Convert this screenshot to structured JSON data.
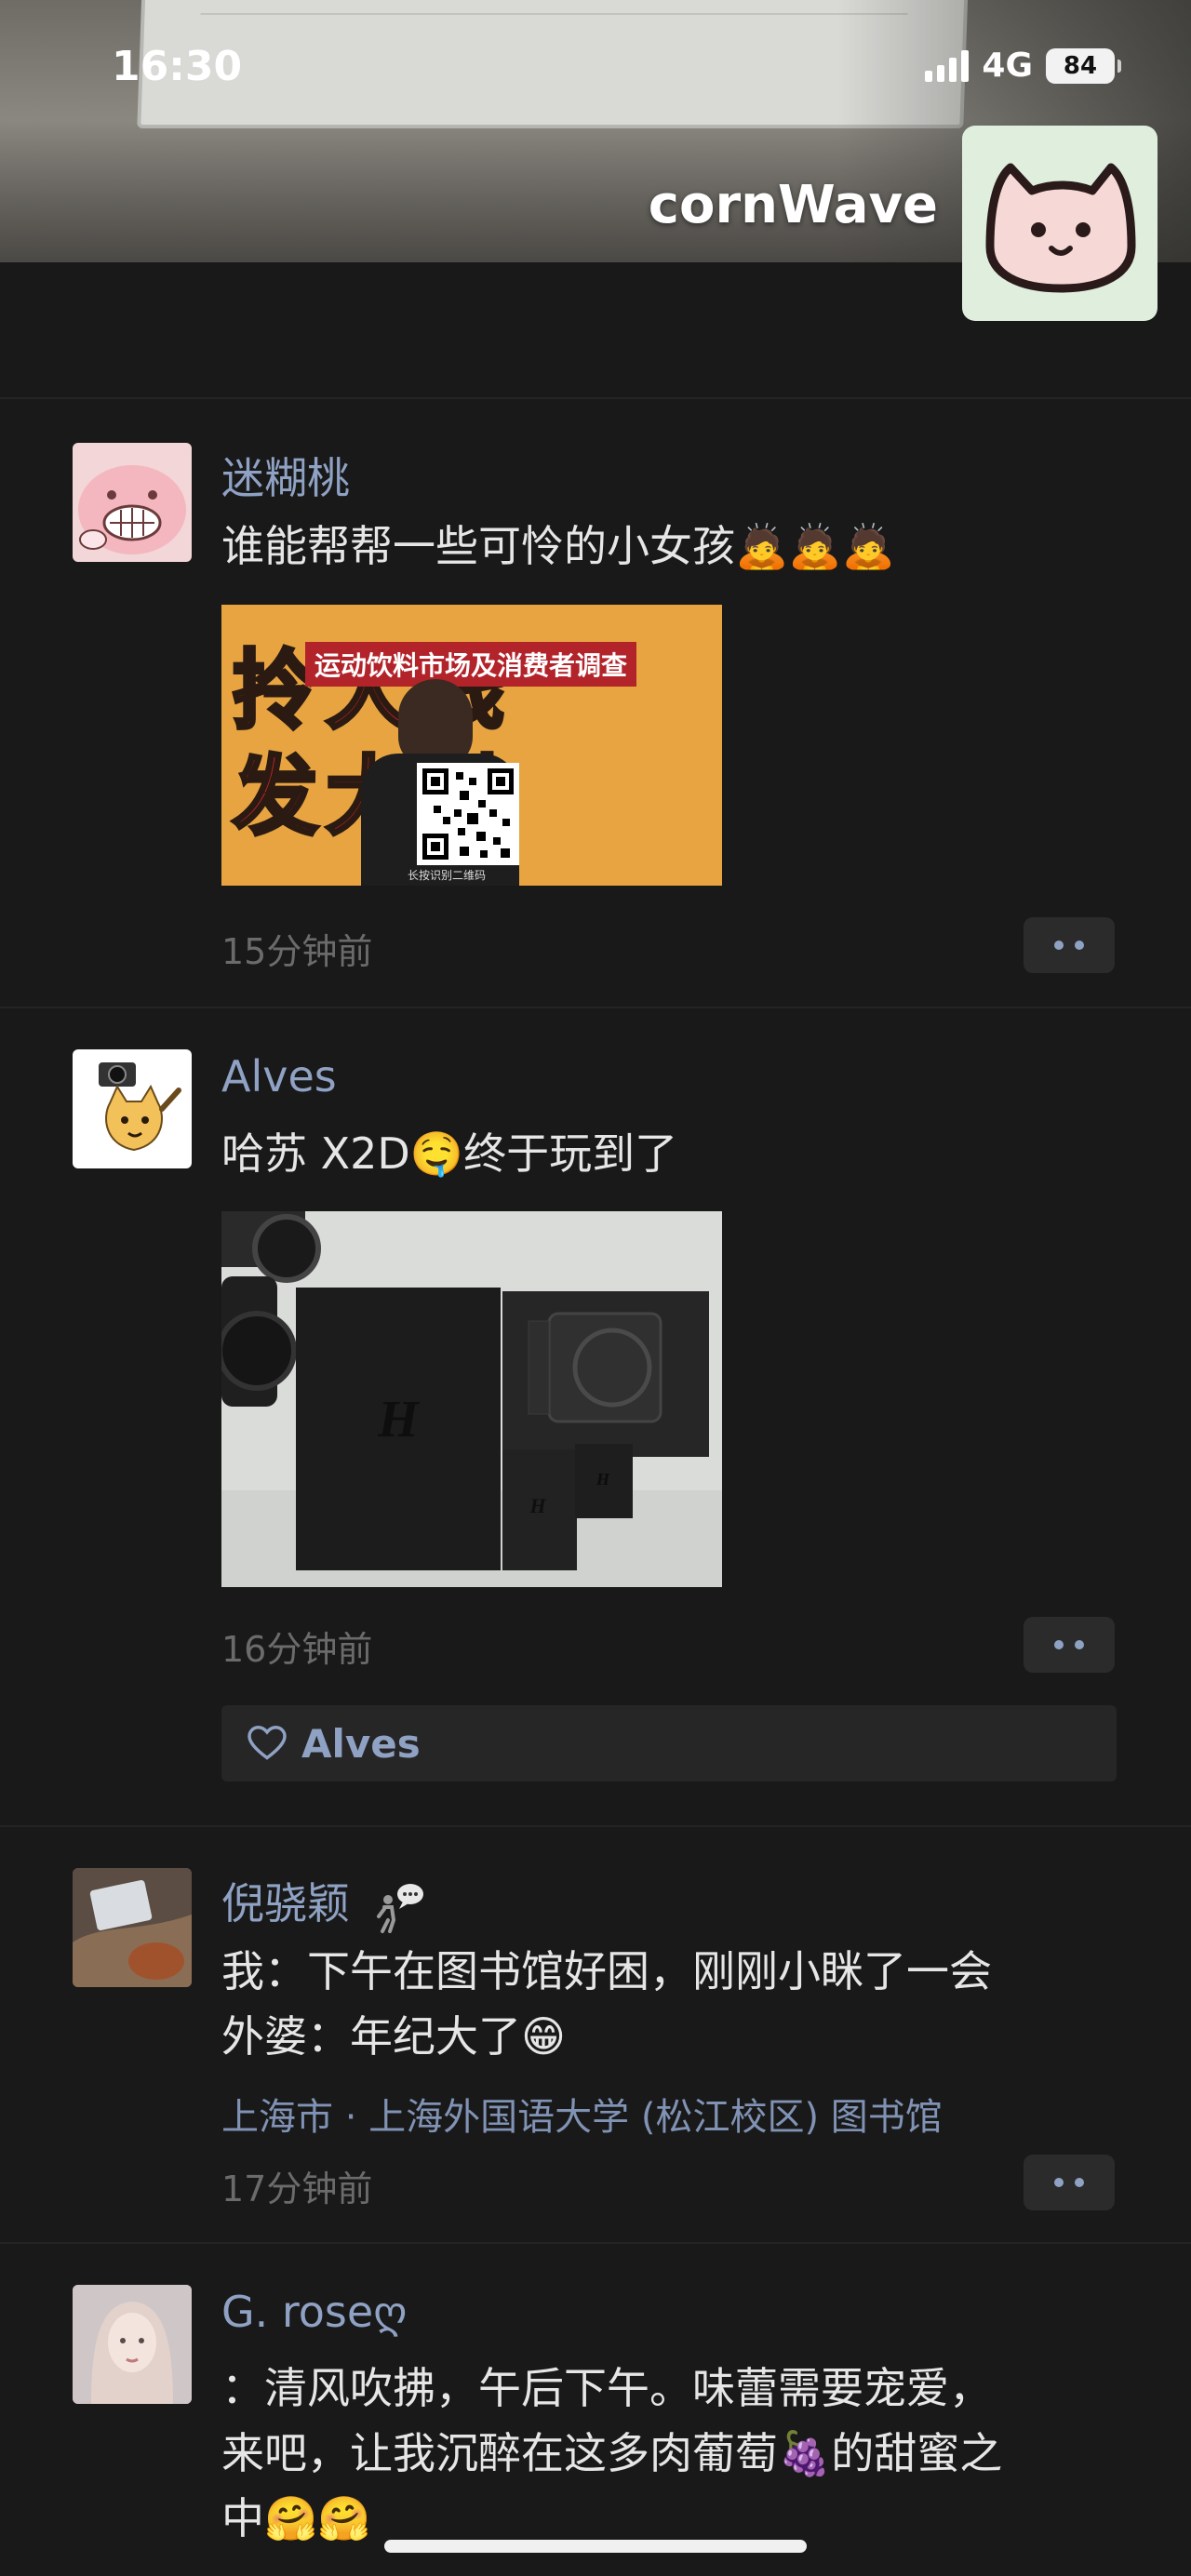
{
  "status_bar": {
    "time": "16:30",
    "network": "4G",
    "battery": "84"
  },
  "profile": {
    "name": "cornWave"
  },
  "posts": [
    {
      "username": "迷糊桃",
      "text": "谁能帮帮一些可怜的小女孩",
      "emoji": "🙇🙇🙇",
      "image": {
        "banner": "运动饮料市场及消费者调查",
        "big_top": "拎大钱",
        "big_bottom": "发大财",
        "caption": "长按识别二维码"
      },
      "time": "15分钟前"
    },
    {
      "username": "Alves",
      "text": "哈苏 X2D",
      "emoji": "🤤",
      "text_after": "终于玩到了",
      "time": "16分钟前",
      "likes": [
        "Alves"
      ]
    },
    {
      "username": "倪骁颖",
      "lines": [
        "我：下午在图书馆好困，刚刚小眯了一会",
        "外婆：年纪大了"
      ],
      "emoji": "😁",
      "location": "上海市 · 上海外国语大学 (松江校区) 图书馆",
      "time": "17分钟前"
    },
    {
      "username": "G. rose",
      "username_suffix": "ღ",
      "lines": [
        "：清风吹拂，午后下午。味蕾需要宠爱，",
        "来吧，让我沉醉在这多肉葡萄",
        "的甜蜜之",
        "中"
      ],
      "emoji_grape": "🍇",
      "emoji_end": "🤗🤗"
    }
  ]
}
